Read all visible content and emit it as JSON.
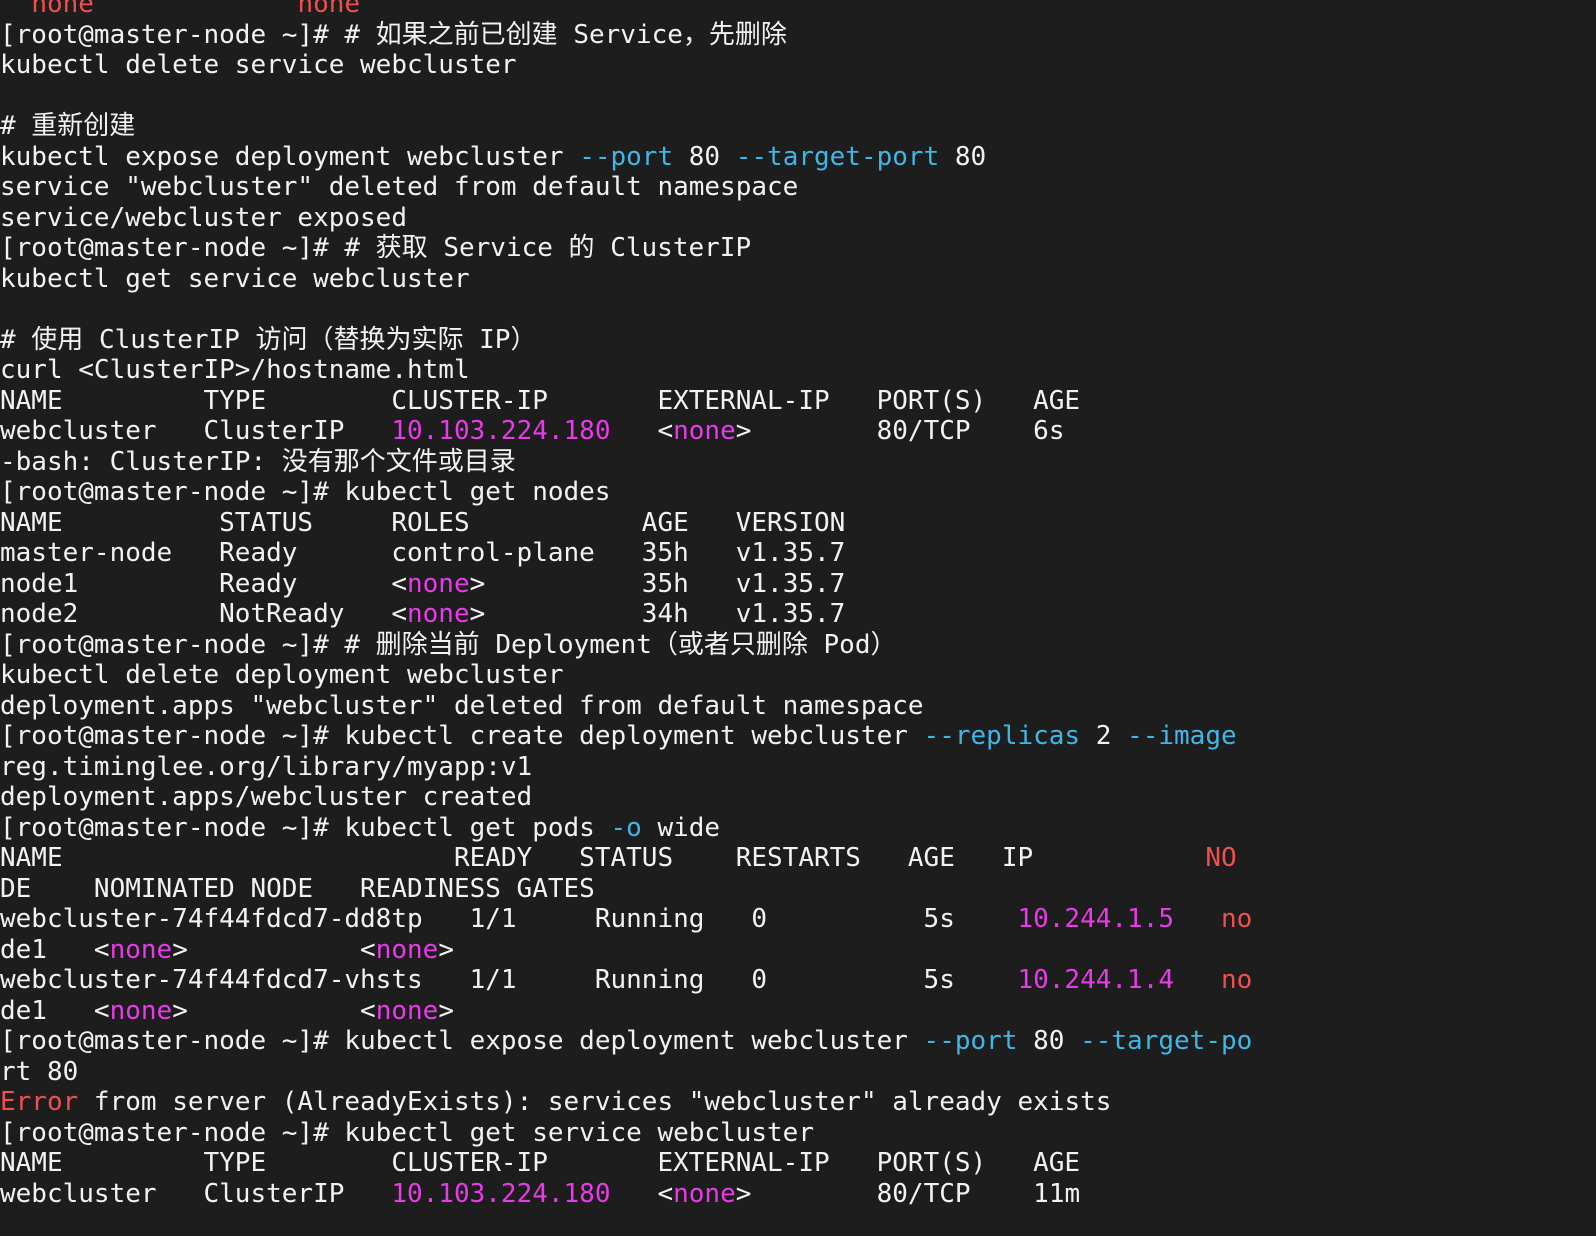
{
  "terminal": {
    "lines": [
      {
        "segments": [
          {
            "text": "  "
          },
          {
            "text": "none",
            "color": "red"
          },
          {
            "text": "             "
          },
          {
            "text": "none",
            "color": "red"
          }
        ]
      },
      {
        "segments": [
          {
            "text": "[root@master-node ~]# # 如果之前已创建 Service，先删除"
          }
        ]
      },
      {
        "segments": [
          {
            "text": "kubectl delete service webcluster"
          }
        ]
      },
      {
        "segments": []
      },
      {
        "segments": [
          {
            "text": "# 重新创建"
          }
        ]
      },
      {
        "segments": [
          {
            "text": "kubectl expose deployment webcluster "
          },
          {
            "text": "--port",
            "color": "cyan"
          },
          {
            "text": " 80 "
          },
          {
            "text": "--target-port",
            "color": "cyan"
          },
          {
            "text": " 80"
          }
        ]
      },
      {
        "segments": [
          {
            "text": "service \"webcluster\" deleted from default namespace"
          }
        ]
      },
      {
        "segments": [
          {
            "text": "service/webcluster exposed"
          }
        ]
      },
      {
        "segments": [
          {
            "text": "[root@master-node ~]# # 获取 Service 的 ClusterIP"
          }
        ]
      },
      {
        "segments": [
          {
            "text": "kubectl get service webcluster"
          }
        ]
      },
      {
        "segments": []
      },
      {
        "segments": [
          {
            "text": "# 使用 ClusterIP 访问（替换为实际 IP）"
          }
        ]
      },
      {
        "segments": [
          {
            "text": "curl <ClusterIP>/hostname.html"
          }
        ]
      },
      {
        "segments": [
          {
            "text": "NAME         TYPE        CLUSTER-IP       EXTERNAL-IP   PORT(S)   AGE"
          }
        ]
      },
      {
        "segments": [
          {
            "text": "webcluster   ClusterIP   "
          },
          {
            "text": "10.103.224.180",
            "color": "magenta"
          },
          {
            "text": "   <"
          },
          {
            "text": "none",
            "color": "magenta"
          },
          {
            "text": ">        80/TCP    6s"
          }
        ]
      },
      {
        "segments": [
          {
            "text": "-bash: ClusterIP: 没有那个文件或目录"
          }
        ]
      },
      {
        "segments": [
          {
            "text": "[root@master-node ~]# kubectl get nodes"
          }
        ]
      },
      {
        "segments": [
          {
            "text": "NAME          STATUS     ROLES           AGE   VERSION"
          }
        ]
      },
      {
        "segments": [
          {
            "text": "master-node   Ready      control-plane   35h   v1.35.7"
          }
        ]
      },
      {
        "segments": [
          {
            "text": "node1         Ready      <"
          },
          {
            "text": "none",
            "color": "magenta"
          },
          {
            "text": ">          35h   v1.35.7"
          }
        ]
      },
      {
        "segments": [
          {
            "text": "node2         NotReady   <"
          },
          {
            "text": "none",
            "color": "magenta"
          },
          {
            "text": ">          34h   v1.35.7"
          }
        ]
      },
      {
        "segments": [
          {
            "text": "[root@master-node ~]# # 删除当前 Deployment（或者只删除 Pod）"
          }
        ]
      },
      {
        "segments": [
          {
            "text": "kubectl delete deployment webcluster"
          }
        ]
      },
      {
        "segments": [
          {
            "text": "deployment.apps \"webcluster\" deleted from default namespace"
          }
        ]
      },
      {
        "segments": [
          {
            "text": "[root@master-node ~]# kubectl create deployment webcluster "
          },
          {
            "text": "--replicas",
            "color": "cyan"
          },
          {
            "text": " 2 "
          },
          {
            "text": "--image",
            "color": "cyan"
          }
        ]
      },
      {
        "segments": [
          {
            "text": "reg.timinglee.org/library/myapp:v1"
          }
        ]
      },
      {
        "segments": [
          {
            "text": "deployment.apps/webcluster created"
          }
        ]
      },
      {
        "segments": [
          {
            "text": "[root@master-node ~]# kubectl get pods "
          },
          {
            "text": "-o",
            "color": "cyan"
          },
          {
            "text": " wide"
          }
        ]
      },
      {
        "segments": [
          {
            "text": "NAME                         READY   STATUS    RESTARTS   AGE   IP           "
          },
          {
            "text": "NO",
            "color": "red"
          }
        ]
      },
      {
        "segments": [
          {
            "text": "DE    NOMINATED NODE   READINESS GATES"
          }
        ]
      },
      {
        "segments": [
          {
            "text": "webcluster-74f44fdcd7-dd8tp   1/1     Running   0          5s    "
          },
          {
            "text": "10.244.1.5",
            "color": "magenta"
          },
          {
            "text": "   "
          },
          {
            "text": "no",
            "color": "red"
          }
        ]
      },
      {
        "segments": [
          {
            "text": "de1   <"
          },
          {
            "text": "none",
            "color": "magenta"
          },
          {
            "text": ">           <"
          },
          {
            "text": "none",
            "color": "magenta"
          },
          {
            "text": ">"
          }
        ]
      },
      {
        "segments": [
          {
            "text": "webcluster-74f44fdcd7-vhsts   1/1     Running   0          5s    "
          },
          {
            "text": "10.244.1.4",
            "color": "magenta"
          },
          {
            "text": "   "
          },
          {
            "text": "no",
            "color": "red"
          }
        ]
      },
      {
        "segments": [
          {
            "text": "de1   <"
          },
          {
            "text": "none",
            "color": "magenta"
          },
          {
            "text": ">           <"
          },
          {
            "text": "none",
            "color": "magenta"
          },
          {
            "text": ">"
          }
        ]
      },
      {
        "segments": [
          {
            "text": "[root@master-node ~]# kubectl expose deployment webcluster "
          },
          {
            "text": "--port",
            "color": "cyan"
          },
          {
            "text": " 80 "
          },
          {
            "text": "--target-po",
            "color": "cyan"
          }
        ]
      },
      {
        "segments": [
          {
            "text": "rt 80"
          }
        ]
      },
      {
        "segments": [
          {
            "text": "Error",
            "color": "red"
          },
          {
            "text": " from server (AlreadyExists): services \"webcluster\" already exists"
          }
        ]
      },
      {
        "segments": [
          {
            "text": "[root@master-node ~]# kubectl get service webcluster"
          }
        ]
      },
      {
        "segments": [
          {
            "text": "NAME         TYPE        CLUSTER-IP       EXTERNAL-IP   PORT(S)   AGE"
          }
        ]
      },
      {
        "segments": [
          {
            "text": "webcluster   ClusterIP   "
          },
          {
            "text": "10.103.224.180",
            "color": "magenta"
          },
          {
            "text": "   <"
          },
          {
            "text": "none",
            "color": "magenta"
          },
          {
            "text": ">        80/TCP    11m"
          }
        ]
      }
    ]
  },
  "colors": {
    "background": "#1d1d1d",
    "foreground": "#f2f2f2",
    "cyan": "#3fb7e6",
    "magenta": "#e83ae8",
    "red": "#ef4f4f"
  }
}
